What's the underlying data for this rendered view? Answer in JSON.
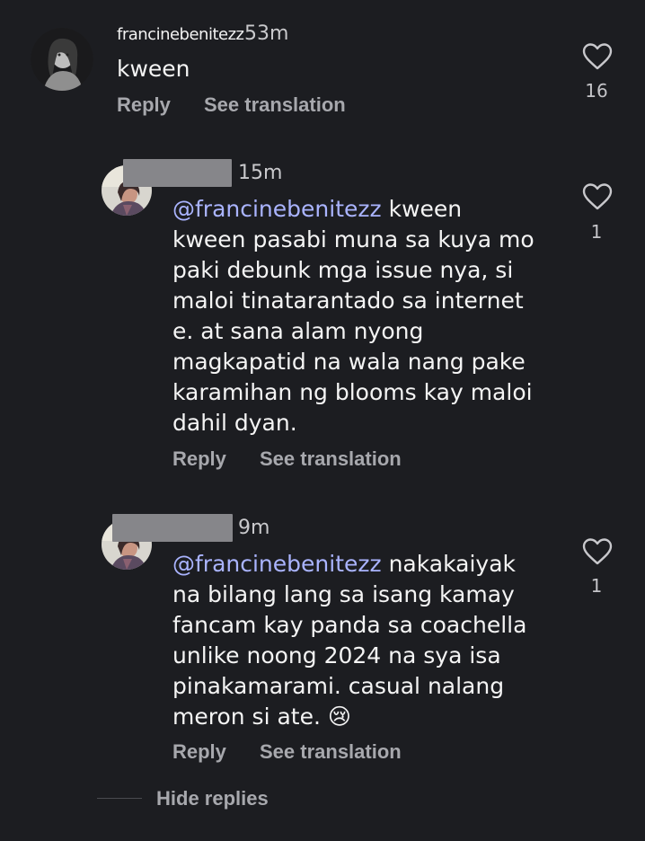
{
  "comments": [
    {
      "username": "francinebenitezz",
      "time": "53m",
      "text": "kween",
      "reply_label": "Reply",
      "translate_label": "See translation",
      "likes": "16"
    },
    {
      "username": "",
      "time": "15m",
      "mention": "@francinebenitezz",
      "text": " kween\nkween pasabi muna sa kuya mo\npaki debunk mga issue nya, si\nmaloi tinatarantado sa internet\ne. at sana alam nyong\nmagkapatid na wala nang pake\nkaramihan ng blooms kay maloi\ndahil dyan.",
      "reply_label": "Reply",
      "translate_label": "See translation",
      "likes": "1"
    },
    {
      "username": "",
      "time": "9m",
      "mention": "@francinebenitezz",
      "text": " nakakaiyak\nna bilang lang sa isang kamay\nfancam kay panda sa coachella\nunlike noong 2024 na sya isa\npinakamarami. casual nalang\nmeron si ate. 😢",
      "reply_label": "Reply",
      "translate_label": "See translation",
      "likes": "1"
    }
  ],
  "hide_replies_label": "Hide replies",
  "icons": {
    "like": "heart-outline-icon"
  },
  "colors": {
    "background": "#1c1d21",
    "mention": "#aab4ff",
    "muted": "#a7a8ad"
  }
}
